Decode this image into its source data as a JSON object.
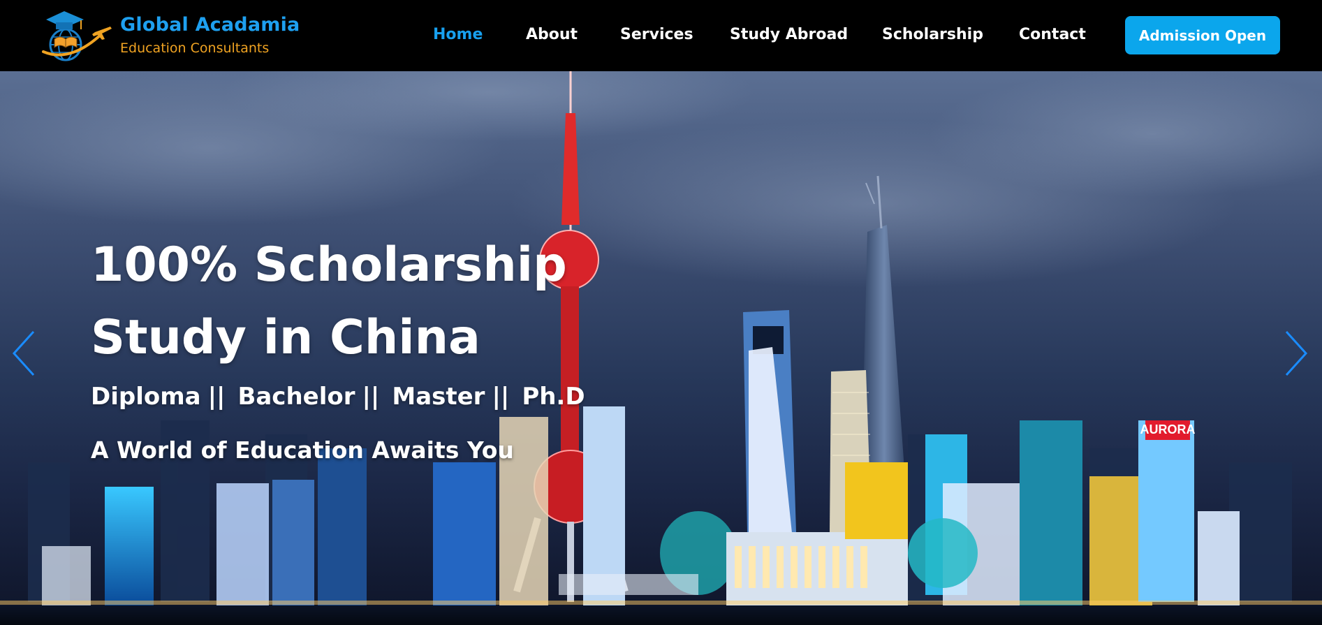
{
  "brand": {
    "name": "Global Acadamia",
    "tagline": "Education Consultants",
    "logo_icon": "graduation-globe-airplane-logo",
    "colors": {
      "primary": "#1ea0f0",
      "secondary": "#f0a322"
    }
  },
  "nav": {
    "items": [
      {
        "label": "Home",
        "active": true
      },
      {
        "label": "About",
        "active": false
      },
      {
        "label": "Services",
        "active": false
      },
      {
        "label": "Study Abroad",
        "active": false
      },
      {
        "label": "Scholarship",
        "active": false
      },
      {
        "label": "Contact",
        "active": false
      }
    ],
    "active_color": "#18a0ee",
    "cta_label": "Admission Open",
    "cta_color": "#0ba6ec"
  },
  "hero": {
    "title_line1": "100% Scholarship",
    "title_line2": "Study in China",
    "degrees": [
      "Diploma",
      "Bachelor",
      "Master",
      "Ph.D"
    ],
    "separator": "||",
    "tagline": "A World of Education Awaits You",
    "background": "night-city-skyline-image",
    "prev_icon": "chevron-left-icon",
    "next_icon": "chevron-right-icon"
  }
}
